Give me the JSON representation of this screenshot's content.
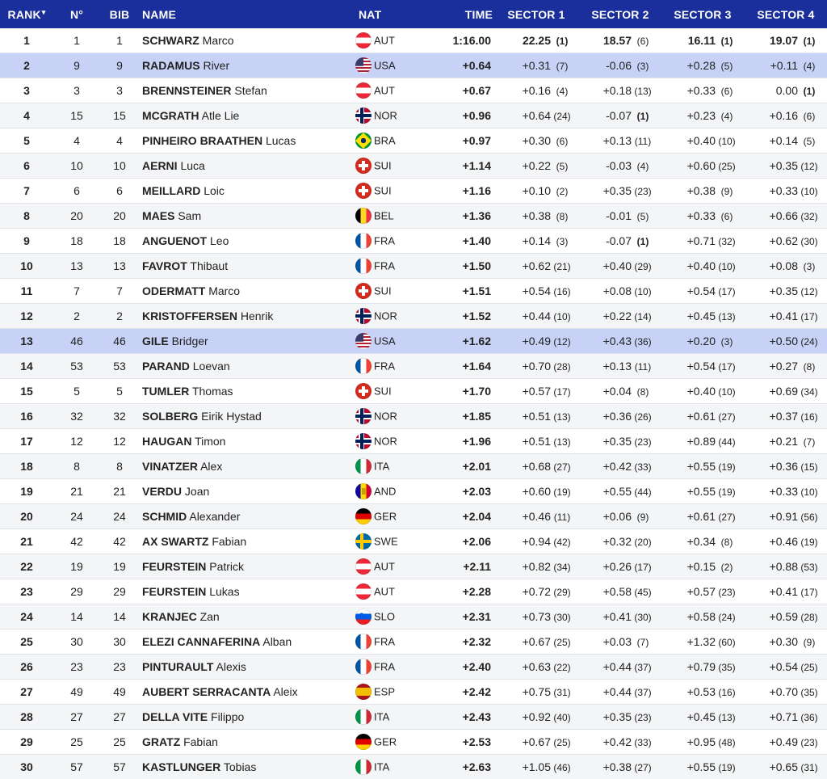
{
  "headers": {
    "rank": "RANK",
    "no": "N°",
    "bib": "BIB",
    "name": "NAME",
    "nat": "NAT",
    "time": "TIME",
    "s1": "SECTOR 1",
    "s2": "SECTOR 2",
    "s3": "SECTOR 3",
    "s4": "SECTOR 4"
  },
  "sort_indicator": "▾",
  "colors": {
    "header_bg": "#1a2f9c",
    "highlight_row": "#c7d2f6",
    "alt_row": "#f4f5f7"
  },
  "rows": [
    {
      "rank": "1",
      "no": "1",
      "bib": "1",
      "last": "SCHWARZ",
      "first": "Marco",
      "flag": "AUT",
      "nat": "AUT",
      "time": "1:16.00",
      "s": [
        [
          "22.25",
          "(1)"
        ],
        [
          "18.57",
          "(6)"
        ],
        [
          "16.11",
          "(1)"
        ],
        [
          "19.07",
          "(1)"
        ]
      ]
    },
    {
      "rank": "2",
      "no": "9",
      "bib": "9",
      "last": "RADAMUS",
      "first": "River",
      "flag": "USA",
      "nat": "USA",
      "time": "+0.64",
      "hl": true,
      "s": [
        [
          "+0.31",
          "(7)"
        ],
        [
          "-0.06",
          "(3)"
        ],
        [
          "+0.28",
          "(5)"
        ],
        [
          "+0.11",
          "(4)"
        ]
      ]
    },
    {
      "rank": "3",
      "no": "3",
      "bib": "3",
      "last": "BRENNSTEINER",
      "first": "Stefan",
      "flag": "AUT",
      "nat": "AUT",
      "time": "+0.67",
      "s": [
        [
          "+0.16",
          "(4)"
        ],
        [
          "+0.18",
          "(13)"
        ],
        [
          "+0.33",
          "(6)"
        ],
        [
          "0.00",
          "(1)"
        ]
      ]
    },
    {
      "rank": "4",
      "no": "15",
      "bib": "15",
      "last": "MCGRATH",
      "first": "Atle Lie",
      "flag": "NOR",
      "nat": "NOR",
      "time": "+0.96",
      "s": [
        [
          "+0.64",
          "(24)"
        ],
        [
          "-0.07",
          "(1)"
        ],
        [
          "+0.23",
          "(4)"
        ],
        [
          "+0.16",
          "(6)"
        ]
      ]
    },
    {
      "rank": "5",
      "no": "4",
      "bib": "4",
      "last": "PINHEIRO BRAATHEN",
      "first": "Lucas",
      "flag": "BRA",
      "nat": "BRA",
      "time": "+0.97",
      "s": [
        [
          "+0.30",
          "(6)"
        ],
        [
          "+0.13",
          "(11)"
        ],
        [
          "+0.40",
          "(10)"
        ],
        [
          "+0.14",
          "(5)"
        ]
      ]
    },
    {
      "rank": "6",
      "no": "10",
      "bib": "10",
      "last": "AERNI",
      "first": "Luca",
      "flag": "SUI",
      "nat": "SUI",
      "time": "+1.14",
      "s": [
        [
          "+0.22",
          "(5)"
        ],
        [
          "-0.03",
          "(4)"
        ],
        [
          "+0.60",
          "(25)"
        ],
        [
          "+0.35",
          "(12)"
        ]
      ]
    },
    {
      "rank": "7",
      "no": "6",
      "bib": "6",
      "last": "MEILLARD",
      "first": "Loic",
      "flag": "SUI",
      "nat": "SUI",
      "time": "+1.16",
      "s": [
        [
          "+0.10",
          "(2)"
        ],
        [
          "+0.35",
          "(23)"
        ],
        [
          "+0.38",
          "(9)"
        ],
        [
          "+0.33",
          "(10)"
        ]
      ]
    },
    {
      "rank": "8",
      "no": "20",
      "bib": "20",
      "last": "MAES",
      "first": "Sam",
      "flag": "BEL",
      "nat": "BEL",
      "time": "+1.36",
      "s": [
        [
          "+0.38",
          "(8)"
        ],
        [
          "-0.01",
          "(5)"
        ],
        [
          "+0.33",
          "(6)"
        ],
        [
          "+0.66",
          "(32)"
        ]
      ]
    },
    {
      "rank": "9",
      "no": "18",
      "bib": "18",
      "last": "ANGUENOT",
      "first": "Leo",
      "flag": "FRA",
      "nat": "FRA",
      "time": "+1.40",
      "s": [
        [
          "+0.14",
          "(3)"
        ],
        [
          "-0.07",
          "(1)"
        ],
        [
          "+0.71",
          "(32)"
        ],
        [
          "+0.62",
          "(30)"
        ]
      ]
    },
    {
      "rank": "10",
      "no": "13",
      "bib": "13",
      "last": "FAVROT",
      "first": "Thibaut",
      "flag": "FRA",
      "nat": "FRA",
      "time": "+1.50",
      "s": [
        [
          "+0.62",
          "(21)"
        ],
        [
          "+0.40",
          "(29)"
        ],
        [
          "+0.40",
          "(10)"
        ],
        [
          "+0.08",
          "(3)"
        ]
      ]
    },
    {
      "rank": "11",
      "no": "7",
      "bib": "7",
      "last": "ODERMATT",
      "first": "Marco",
      "flag": "SUI",
      "nat": "SUI",
      "time": "+1.51",
      "s": [
        [
          "+0.54",
          "(16)"
        ],
        [
          "+0.08",
          "(10)"
        ],
        [
          "+0.54",
          "(17)"
        ],
        [
          "+0.35",
          "(12)"
        ]
      ]
    },
    {
      "rank": "12",
      "no": "2",
      "bib": "2",
      "last": "KRISTOFFERSEN",
      "first": "Henrik",
      "flag": "NOR",
      "nat": "NOR",
      "time": "+1.52",
      "s": [
        [
          "+0.44",
          "(10)"
        ],
        [
          "+0.22",
          "(14)"
        ],
        [
          "+0.45",
          "(13)"
        ],
        [
          "+0.41",
          "(17)"
        ]
      ]
    },
    {
      "rank": "13",
      "no": "46",
      "bib": "46",
      "last": "GILE",
      "first": "Bridger",
      "flag": "USA",
      "nat": "USA",
      "time": "+1.62",
      "hl": true,
      "s": [
        [
          "+0.49",
          "(12)"
        ],
        [
          "+0.43",
          "(36)"
        ],
        [
          "+0.20",
          "(3)"
        ],
        [
          "+0.50",
          "(24)"
        ]
      ]
    },
    {
      "rank": "14",
      "no": "53",
      "bib": "53",
      "last": "PARAND",
      "first": "Loevan",
      "flag": "FRA",
      "nat": "FRA",
      "time": "+1.64",
      "s": [
        [
          "+0.70",
          "(28)"
        ],
        [
          "+0.13",
          "(11)"
        ],
        [
          "+0.54",
          "(17)"
        ],
        [
          "+0.27",
          "(8)"
        ]
      ]
    },
    {
      "rank": "15",
      "no": "5",
      "bib": "5",
      "last": "TUMLER",
      "first": "Thomas",
      "flag": "SUI",
      "nat": "SUI",
      "time": "+1.70",
      "s": [
        [
          "+0.57",
          "(17)"
        ],
        [
          "+0.04",
          "(8)"
        ],
        [
          "+0.40",
          "(10)"
        ],
        [
          "+0.69",
          "(34)"
        ]
      ]
    },
    {
      "rank": "16",
      "no": "32",
      "bib": "32",
      "last": "SOLBERG",
      "first": "Eirik Hystad",
      "flag": "NOR",
      "nat": "NOR",
      "time": "+1.85",
      "s": [
        [
          "+0.51",
          "(13)"
        ],
        [
          "+0.36",
          "(26)"
        ],
        [
          "+0.61",
          "(27)"
        ],
        [
          "+0.37",
          "(16)"
        ]
      ]
    },
    {
      "rank": "17",
      "no": "12",
      "bib": "12",
      "last": "HAUGAN",
      "first": "Timon",
      "flag": "NOR",
      "nat": "NOR",
      "time": "+1.96",
      "s": [
        [
          "+0.51",
          "(13)"
        ],
        [
          "+0.35",
          "(23)"
        ],
        [
          "+0.89",
          "(44)"
        ],
        [
          "+0.21",
          "(7)"
        ]
      ]
    },
    {
      "rank": "18",
      "no": "8",
      "bib": "8",
      "last": "VINATZER",
      "first": "Alex",
      "flag": "ITA",
      "nat": "ITA",
      "time": "+2.01",
      "s": [
        [
          "+0.68",
          "(27)"
        ],
        [
          "+0.42",
          "(33)"
        ],
        [
          "+0.55",
          "(19)"
        ],
        [
          "+0.36",
          "(15)"
        ]
      ]
    },
    {
      "rank": "19",
      "no": "21",
      "bib": "21",
      "last": "VERDU",
      "first": "Joan",
      "flag": "AND",
      "nat": "AND",
      "time": "+2.03",
      "s": [
        [
          "+0.60",
          "(19)"
        ],
        [
          "+0.55",
          "(44)"
        ],
        [
          "+0.55",
          "(19)"
        ],
        [
          "+0.33",
          "(10)"
        ]
      ]
    },
    {
      "rank": "20",
      "no": "24",
      "bib": "24",
      "last": "SCHMID",
      "first": "Alexander",
      "flag": "GER",
      "nat": "GER",
      "time": "+2.04",
      "s": [
        [
          "+0.46",
          "(11)"
        ],
        [
          "+0.06",
          "(9)"
        ],
        [
          "+0.61",
          "(27)"
        ],
        [
          "+0.91",
          "(56)"
        ]
      ]
    },
    {
      "rank": "21",
      "no": "42",
      "bib": "42",
      "last": "AX SWARTZ",
      "first": "Fabian",
      "flag": "SWE",
      "nat": "SWE",
      "time": "+2.06",
      "s": [
        [
          "+0.94",
          "(42)"
        ],
        [
          "+0.32",
          "(20)"
        ],
        [
          "+0.34",
          "(8)"
        ],
        [
          "+0.46",
          "(19)"
        ]
      ]
    },
    {
      "rank": "22",
      "no": "19",
      "bib": "19",
      "last": "FEURSTEIN",
      "first": "Patrick",
      "flag": "AUT",
      "nat": "AUT",
      "time": "+2.11",
      "s": [
        [
          "+0.82",
          "(34)"
        ],
        [
          "+0.26",
          "(17)"
        ],
        [
          "+0.15",
          "(2)"
        ],
        [
          "+0.88",
          "(53)"
        ]
      ]
    },
    {
      "rank": "23",
      "no": "29",
      "bib": "29",
      "last": "FEURSTEIN",
      "first": "Lukas",
      "flag": "AUT",
      "nat": "AUT",
      "time": "+2.28",
      "s": [
        [
          "+0.72",
          "(29)"
        ],
        [
          "+0.58",
          "(45)"
        ],
        [
          "+0.57",
          "(23)"
        ],
        [
          "+0.41",
          "(17)"
        ]
      ]
    },
    {
      "rank": "24",
      "no": "14",
      "bib": "14",
      "last": "KRANJEC",
      "first": "Zan",
      "flag": "SLO",
      "nat": "SLO",
      "time": "+2.31",
      "s": [
        [
          "+0.73",
          "(30)"
        ],
        [
          "+0.41",
          "(30)"
        ],
        [
          "+0.58",
          "(24)"
        ],
        [
          "+0.59",
          "(28)"
        ]
      ]
    },
    {
      "rank": "25",
      "no": "30",
      "bib": "30",
      "last": "ELEZI CANNAFERINA",
      "first": "Alban",
      "flag": "FRA",
      "nat": "FRA",
      "time": "+2.32",
      "s": [
        [
          "+0.67",
          "(25)"
        ],
        [
          "+0.03",
          "(7)"
        ],
        [
          "+1.32",
          "(60)"
        ],
        [
          "+0.30",
          "(9)"
        ]
      ]
    },
    {
      "rank": "26",
      "no": "23",
      "bib": "23",
      "last": "PINTURAULT",
      "first": "Alexis",
      "flag": "FRA",
      "nat": "FRA",
      "time": "+2.40",
      "s": [
        [
          "+0.63",
          "(22)"
        ],
        [
          "+0.44",
          "(37)"
        ],
        [
          "+0.79",
          "(35)"
        ],
        [
          "+0.54",
          "(25)"
        ]
      ]
    },
    {
      "rank": "27",
      "no": "49",
      "bib": "49",
      "last": "AUBERT SERRACANTA",
      "first": "Aleix",
      "flag": "ESP",
      "nat": "ESP",
      "time": "+2.42",
      "s": [
        [
          "+0.75",
          "(31)"
        ],
        [
          "+0.44",
          "(37)"
        ],
        [
          "+0.53",
          "(16)"
        ],
        [
          "+0.70",
          "(35)"
        ]
      ]
    },
    {
      "rank": "28",
      "no": "27",
      "bib": "27",
      "last": "DELLA VITE",
      "first": "Filippo",
      "flag": "ITA",
      "nat": "ITA",
      "time": "+2.43",
      "s": [
        [
          "+0.92",
          "(40)"
        ],
        [
          "+0.35",
          "(23)"
        ],
        [
          "+0.45",
          "(13)"
        ],
        [
          "+0.71",
          "(36)"
        ]
      ]
    },
    {
      "rank": "29",
      "no": "25",
      "bib": "25",
      "last": "GRATZ",
      "first": "Fabian",
      "flag": "GER",
      "nat": "GER",
      "time": "+2.53",
      "s": [
        [
          "+0.67",
          "(25)"
        ],
        [
          "+0.42",
          "(33)"
        ],
        [
          "+0.95",
          "(48)"
        ],
        [
          "+0.49",
          "(23)"
        ]
      ]
    },
    {
      "rank": "30",
      "no": "57",
      "bib": "57",
      "last": "KASTLUNGER",
      "first": "Tobias",
      "flag": "ITA",
      "nat": "ITA",
      "time": "+2.63",
      "s": [
        [
          "+1.05",
          "(46)"
        ],
        [
          "+0.38",
          "(27)"
        ],
        [
          "+0.55",
          "(19)"
        ],
        [
          "+0.65",
          "(31)"
        ]
      ]
    }
  ]
}
